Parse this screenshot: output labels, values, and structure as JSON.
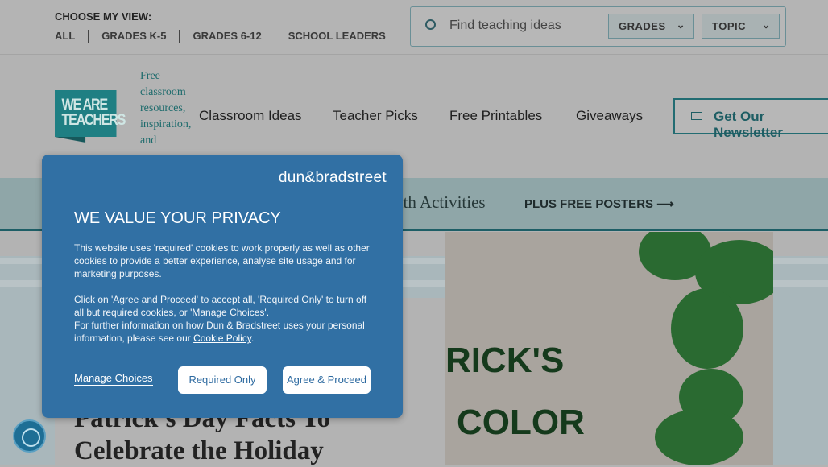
{
  "top_bar": {
    "choose_label": "CHOOSE MY VIEW:",
    "views": [
      "ALL",
      "GRADES K-5",
      "GRADES 6-12",
      "SCHOOL LEADERS"
    ],
    "search": {
      "placeholder": "Find teaching ideas",
      "icon": "search-icon"
    },
    "grades_label": "GRADES",
    "topic_label": "TOPIC"
  },
  "header": {
    "logo_text": "WE ARE TEACHERS",
    "tagline": "Free classroom resources, inspiration, and",
    "nav": [
      "Classroom Ideas",
      "Teacher Picks",
      "Free Printables",
      "Giveaways"
    ],
    "newsletter_label": "Get Our Newsletter"
  },
  "banner": {
    "text": "nth Activities",
    "cta": "PLUS FREE POSTERS"
  },
  "article": {
    "title_line1": "Patrick's Day Facts To",
    "title_line2": "Celebrate the Holiday",
    "image_text": [
      "RICK'S",
      "COLOR"
    ]
  },
  "consent": {
    "brand": "dun&bradstreet",
    "title": "WE VALUE YOUR PRIVACY",
    "para1": "This website uses 'required' cookies to work properly as well as other cookies to provide a better experience, analyse site usage and for marketing purposes.",
    "para2a": "Click on 'Agree and Proceed' to accept all, 'Required Only' to turn off all but required cookies, or 'Manage Choices'.",
    "para2b": "For further information on how Dun & Bradstreet uses your personal information, please see our",
    "cookie_policy": "Cookie Policy",
    "manage": "Manage Choices",
    "required": "Required Only",
    "agree": "Agree & Proceed"
  },
  "colors": {
    "modal": "#3170a4",
    "brand_teal": "#1f7f83"
  }
}
